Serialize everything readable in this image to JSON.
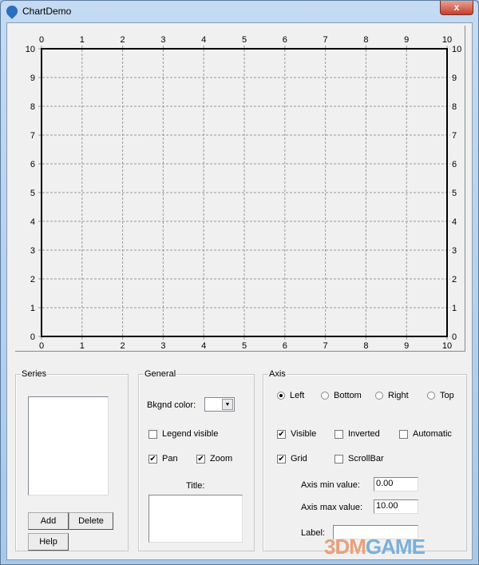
{
  "window": {
    "title": "ChartDemo",
    "close_label": "x"
  },
  "chart_data": {
    "type": "line",
    "title": "",
    "series": [],
    "x_axis": {
      "min": 0,
      "max": 10,
      "ticks": [
        0,
        1,
        2,
        3,
        4,
        5,
        6,
        7,
        8,
        9,
        10
      ]
    },
    "y_axis": {
      "min": 0,
      "max": 10,
      "ticks": [
        0,
        1,
        2,
        3,
        4,
        5,
        6,
        7,
        8,
        9,
        10
      ]
    },
    "grid": true,
    "axes_shown": [
      "left",
      "right",
      "top",
      "bottom"
    ]
  },
  "series_panel": {
    "legend": "Series",
    "add": "Add",
    "delete": "Delete",
    "help": "Help"
  },
  "general_panel": {
    "legend": "General",
    "bkgnd_label": "Bkgnd color:",
    "legend_visible": "Legend visible",
    "legend_visible_checked": false,
    "pan": "Pan",
    "pan_checked": true,
    "zoom": "Zoom",
    "zoom_checked": true,
    "title_label": "Title:",
    "title_value": ""
  },
  "axis_panel": {
    "legend": "Axis",
    "radios": [
      {
        "label": "Left",
        "selected": true
      },
      {
        "label": "Bottom",
        "selected": false
      },
      {
        "label": "Right",
        "selected": false
      },
      {
        "label": "Top",
        "selected": false
      }
    ],
    "visible": "Visible",
    "visible_checked": true,
    "inverted": "Inverted",
    "inverted_checked": false,
    "automatic": "Automatic",
    "automatic_checked": false,
    "grid": "Grid",
    "grid_checked": true,
    "scrollbar": "ScrollBar",
    "scrollbar_checked": false,
    "min_label": "Axis min value:",
    "min_value": "0.00",
    "max_label": "Axis max value:",
    "max_value": "10.00",
    "label_label": "Label:",
    "label_value": ""
  },
  "watermark": {
    "text1": "3DM",
    "text2": "GAME"
  }
}
